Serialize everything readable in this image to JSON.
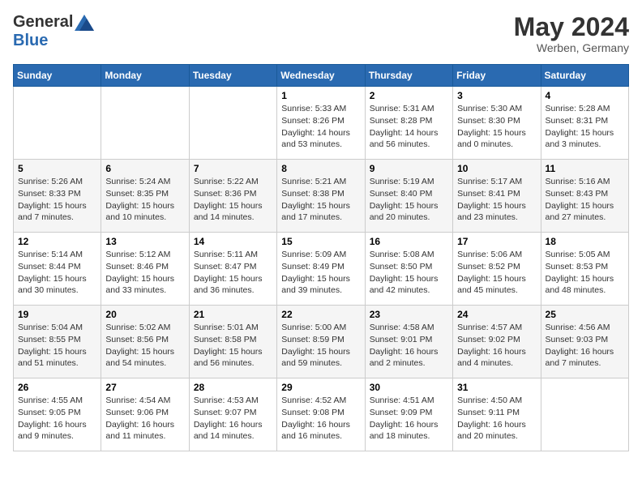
{
  "logo": {
    "general": "General",
    "blue": "Blue"
  },
  "title": {
    "month_year": "May 2024",
    "location": "Werben, Germany"
  },
  "weekdays": [
    "Sunday",
    "Monday",
    "Tuesday",
    "Wednesday",
    "Thursday",
    "Friday",
    "Saturday"
  ],
  "weeks": [
    [
      {
        "day": "",
        "info": ""
      },
      {
        "day": "",
        "info": ""
      },
      {
        "day": "",
        "info": ""
      },
      {
        "day": "1",
        "info": "Sunrise: 5:33 AM\nSunset: 8:26 PM\nDaylight: 14 hours and 53 minutes."
      },
      {
        "day": "2",
        "info": "Sunrise: 5:31 AM\nSunset: 8:28 PM\nDaylight: 14 hours and 56 minutes."
      },
      {
        "day": "3",
        "info": "Sunrise: 5:30 AM\nSunset: 8:30 PM\nDaylight: 15 hours and 0 minutes."
      },
      {
        "day": "4",
        "info": "Sunrise: 5:28 AM\nSunset: 8:31 PM\nDaylight: 15 hours and 3 minutes."
      }
    ],
    [
      {
        "day": "5",
        "info": "Sunrise: 5:26 AM\nSunset: 8:33 PM\nDaylight: 15 hours and 7 minutes."
      },
      {
        "day": "6",
        "info": "Sunrise: 5:24 AM\nSunset: 8:35 PM\nDaylight: 15 hours and 10 minutes."
      },
      {
        "day": "7",
        "info": "Sunrise: 5:22 AM\nSunset: 8:36 PM\nDaylight: 15 hours and 14 minutes."
      },
      {
        "day": "8",
        "info": "Sunrise: 5:21 AM\nSunset: 8:38 PM\nDaylight: 15 hours and 17 minutes."
      },
      {
        "day": "9",
        "info": "Sunrise: 5:19 AM\nSunset: 8:40 PM\nDaylight: 15 hours and 20 minutes."
      },
      {
        "day": "10",
        "info": "Sunrise: 5:17 AM\nSunset: 8:41 PM\nDaylight: 15 hours and 23 minutes."
      },
      {
        "day": "11",
        "info": "Sunrise: 5:16 AM\nSunset: 8:43 PM\nDaylight: 15 hours and 27 minutes."
      }
    ],
    [
      {
        "day": "12",
        "info": "Sunrise: 5:14 AM\nSunset: 8:44 PM\nDaylight: 15 hours and 30 minutes."
      },
      {
        "day": "13",
        "info": "Sunrise: 5:12 AM\nSunset: 8:46 PM\nDaylight: 15 hours and 33 minutes."
      },
      {
        "day": "14",
        "info": "Sunrise: 5:11 AM\nSunset: 8:47 PM\nDaylight: 15 hours and 36 minutes."
      },
      {
        "day": "15",
        "info": "Sunrise: 5:09 AM\nSunset: 8:49 PM\nDaylight: 15 hours and 39 minutes."
      },
      {
        "day": "16",
        "info": "Sunrise: 5:08 AM\nSunset: 8:50 PM\nDaylight: 15 hours and 42 minutes."
      },
      {
        "day": "17",
        "info": "Sunrise: 5:06 AM\nSunset: 8:52 PM\nDaylight: 15 hours and 45 minutes."
      },
      {
        "day": "18",
        "info": "Sunrise: 5:05 AM\nSunset: 8:53 PM\nDaylight: 15 hours and 48 minutes."
      }
    ],
    [
      {
        "day": "19",
        "info": "Sunrise: 5:04 AM\nSunset: 8:55 PM\nDaylight: 15 hours and 51 minutes."
      },
      {
        "day": "20",
        "info": "Sunrise: 5:02 AM\nSunset: 8:56 PM\nDaylight: 15 hours and 54 minutes."
      },
      {
        "day": "21",
        "info": "Sunrise: 5:01 AM\nSunset: 8:58 PM\nDaylight: 15 hours and 56 minutes."
      },
      {
        "day": "22",
        "info": "Sunrise: 5:00 AM\nSunset: 8:59 PM\nDaylight: 15 hours and 59 minutes."
      },
      {
        "day": "23",
        "info": "Sunrise: 4:58 AM\nSunset: 9:01 PM\nDaylight: 16 hours and 2 minutes."
      },
      {
        "day": "24",
        "info": "Sunrise: 4:57 AM\nSunset: 9:02 PM\nDaylight: 16 hours and 4 minutes."
      },
      {
        "day": "25",
        "info": "Sunrise: 4:56 AM\nSunset: 9:03 PM\nDaylight: 16 hours and 7 minutes."
      }
    ],
    [
      {
        "day": "26",
        "info": "Sunrise: 4:55 AM\nSunset: 9:05 PM\nDaylight: 16 hours and 9 minutes."
      },
      {
        "day": "27",
        "info": "Sunrise: 4:54 AM\nSunset: 9:06 PM\nDaylight: 16 hours and 11 minutes."
      },
      {
        "day": "28",
        "info": "Sunrise: 4:53 AM\nSunset: 9:07 PM\nDaylight: 16 hours and 14 minutes."
      },
      {
        "day": "29",
        "info": "Sunrise: 4:52 AM\nSunset: 9:08 PM\nDaylight: 16 hours and 16 minutes."
      },
      {
        "day": "30",
        "info": "Sunrise: 4:51 AM\nSunset: 9:09 PM\nDaylight: 16 hours and 18 minutes."
      },
      {
        "day": "31",
        "info": "Sunrise: 4:50 AM\nSunset: 9:11 PM\nDaylight: 16 hours and 20 minutes."
      },
      {
        "day": "",
        "info": ""
      }
    ]
  ]
}
